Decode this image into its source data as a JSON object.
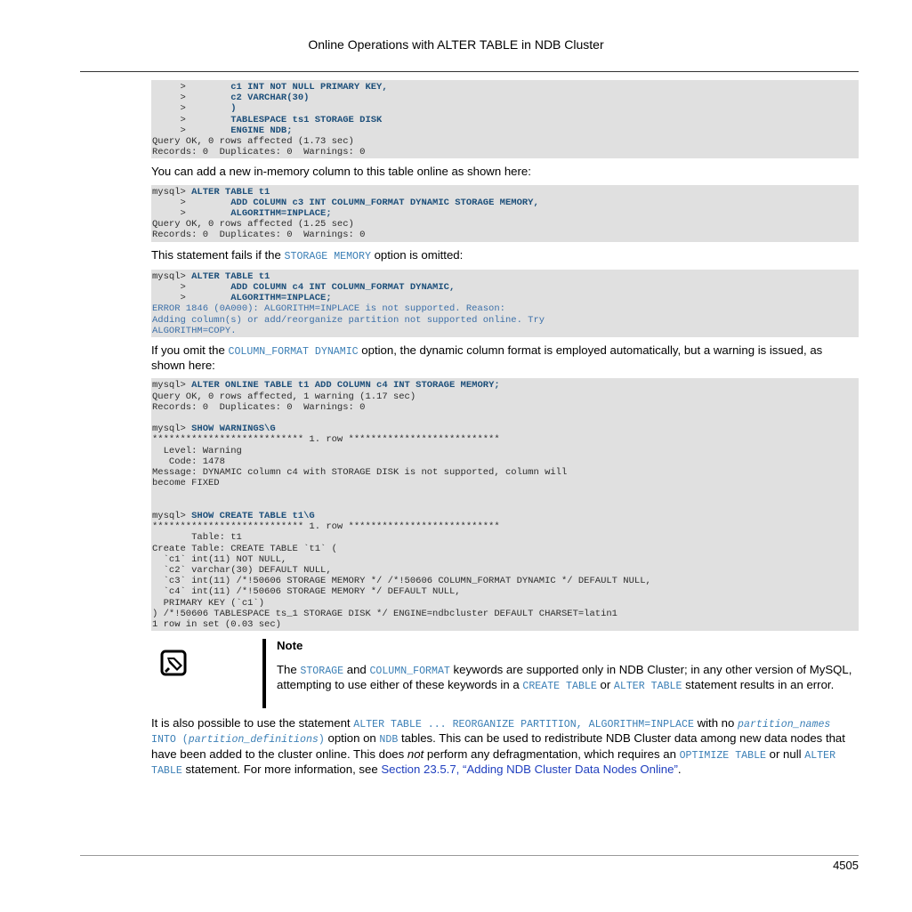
{
  "header": {
    "title": "Online Operations with ALTER TABLE in NDB Cluster"
  },
  "code_blocks": [
    {
      "lines": [
        {
          "segments": [
            {
              "t": "     >        ",
              "s": "plain"
            },
            {
              "t": "c1 INT NOT NULL PRIMARY KEY,",
              "s": "bold"
            }
          ]
        },
        {
          "segments": [
            {
              "t": "     >        ",
              "s": "plain"
            },
            {
              "t": "c2 VARCHAR(30)",
              "s": "bold"
            }
          ]
        },
        {
          "segments": [
            {
              "t": "     >        ",
              "s": "plain"
            },
            {
              "t": ")",
              "s": "bold"
            }
          ]
        },
        {
          "segments": [
            {
              "t": "     >        ",
              "s": "plain"
            },
            {
              "t": "TABLESPACE ts1 STORAGE DISK",
              "s": "bold"
            }
          ]
        },
        {
          "segments": [
            {
              "t": "     >        ",
              "s": "plain"
            },
            {
              "t": "ENGINE NDB;",
              "s": "bold"
            }
          ]
        },
        {
          "segments": [
            {
              "t": "Query OK, 0 rows affected (1.73 sec)",
              "s": "plain"
            }
          ]
        },
        {
          "segments": [
            {
              "t": "Records: 0  Duplicates: 0  Warnings: 0",
              "s": "plain"
            }
          ]
        }
      ]
    },
    {
      "lines": [
        {
          "segments": [
            {
              "t": "mysql> ",
              "s": "plain"
            },
            {
              "t": "ALTER TABLE t1",
              "s": "bold"
            }
          ]
        },
        {
          "segments": [
            {
              "t": "     >        ",
              "s": "plain"
            },
            {
              "t": "ADD COLUMN c3 INT COLUMN_FORMAT DYNAMIC STORAGE MEMORY,",
              "s": "bold"
            }
          ]
        },
        {
          "segments": [
            {
              "t": "     >        ",
              "s": "plain"
            },
            {
              "t": "ALGORITHM=INPLACE;",
              "s": "bold"
            }
          ]
        },
        {
          "segments": [
            {
              "t": "Query OK, 0 rows affected (1.25 sec)",
              "s": "plain"
            }
          ]
        },
        {
          "segments": [
            {
              "t": "Records: 0  Duplicates: 0  Warnings: 0",
              "s": "plain"
            }
          ]
        }
      ]
    },
    {
      "lines": [
        {
          "segments": [
            {
              "t": "mysql> ",
              "s": "plain"
            },
            {
              "t": "ALTER TABLE t1",
              "s": "bold"
            }
          ]
        },
        {
          "segments": [
            {
              "t": "     >        ",
              "s": "plain"
            },
            {
              "t": "ADD COLUMN c4 INT COLUMN_FORMAT DYNAMIC,",
              "s": "bold"
            }
          ]
        },
        {
          "segments": [
            {
              "t": "     >        ",
              "s": "plain"
            },
            {
              "t": "ALGORITHM=INPLACE;",
              "s": "bold"
            }
          ]
        },
        {
          "segments": [
            {
              "t": "ERROR 1846 (0A000): ALGORITHM=INPLACE is not supported. Reason:",
              "s": "err"
            }
          ]
        },
        {
          "segments": [
            {
              "t": "Adding column(s) or add/reorganize partition not supported online. Try",
              "s": "err"
            }
          ]
        },
        {
          "segments": [
            {
              "t": "ALGORITHM=COPY.",
              "s": "err"
            }
          ]
        }
      ]
    },
    {
      "lines": [
        {
          "segments": [
            {
              "t": "mysql> ",
              "s": "plain"
            },
            {
              "t": "ALTER ONLINE TABLE t1 ADD COLUMN c4 INT STORAGE MEMORY;",
              "s": "bold"
            }
          ]
        },
        {
          "segments": [
            {
              "t": "Query OK, 0 rows affected, 1 warning (1.17 sec)",
              "s": "plain"
            }
          ]
        },
        {
          "segments": [
            {
              "t": "Records: 0  Duplicates: 0  Warnings: 0",
              "s": "plain"
            }
          ]
        },
        {
          "segments": [
            {
              "t": "",
              "s": "plain"
            }
          ]
        },
        {
          "segments": [
            {
              "t": "mysql> ",
              "s": "plain"
            },
            {
              "t": "SHOW WARNINGS\\G",
              "s": "bold"
            }
          ]
        },
        {
          "segments": [
            {
              "t": "*************************** 1. row ***************************",
              "s": "plain"
            }
          ]
        },
        {
          "segments": [
            {
              "t": "  Level: Warning",
              "s": "plain"
            }
          ]
        },
        {
          "segments": [
            {
              "t": "   Code: 1478",
              "s": "plain"
            }
          ]
        },
        {
          "segments": [
            {
              "t": "Message: DYNAMIC column c4 with STORAGE DISK is not supported, column will",
              "s": "plain"
            }
          ]
        },
        {
          "segments": [
            {
              "t": "become FIXED",
              "s": "plain"
            }
          ]
        },
        {
          "segments": [
            {
              "t": "",
              "s": "plain"
            }
          ]
        },
        {
          "segments": [
            {
              "t": "",
              "s": "plain"
            }
          ]
        },
        {
          "segments": [
            {
              "t": "mysql> ",
              "s": "plain"
            },
            {
              "t": "SHOW CREATE TABLE t1\\G",
              "s": "bold"
            }
          ]
        },
        {
          "segments": [
            {
              "t": "*************************** 1. row ***************************",
              "s": "plain"
            }
          ]
        },
        {
          "segments": [
            {
              "t": "       Table: t1",
              "s": "plain"
            }
          ]
        },
        {
          "segments": [
            {
              "t": "Create Table: CREATE TABLE `t1` (",
              "s": "plain"
            }
          ]
        },
        {
          "segments": [
            {
              "t": "  `c1` int(11) NOT NULL,",
              "s": "plain"
            }
          ]
        },
        {
          "segments": [
            {
              "t": "  `c2` varchar(30) DEFAULT NULL,",
              "s": "plain"
            }
          ]
        },
        {
          "segments": [
            {
              "t": "  `c3` int(11) /*!50606 STORAGE MEMORY */ /*!50606 COLUMN_FORMAT DYNAMIC */ DEFAULT NULL,",
              "s": "plain"
            }
          ]
        },
        {
          "segments": [
            {
              "t": "  `c4` int(11) /*!50606 STORAGE MEMORY */ DEFAULT NULL,",
              "s": "plain"
            }
          ]
        },
        {
          "segments": [
            {
              "t": "  PRIMARY KEY (`c1`)",
              "s": "plain"
            }
          ]
        },
        {
          "segments": [
            {
              "t": ") /*!50606 TABLESPACE ts_1 STORAGE DISK */ ENGINE=ndbcluster DEFAULT CHARSET=latin1",
              "s": "plain"
            }
          ]
        },
        {
          "segments": [
            {
              "t": "1 row in set (0.03 sec)",
              "s": "plain"
            }
          ]
        }
      ]
    }
  ],
  "paragraphs": [
    {
      "segments": [
        {
          "t": "You can add a new in-memory column to this table online as shown here:",
          "s": "text"
        }
      ]
    },
    {
      "segments": [
        {
          "t": "This statement fails if the ",
          "s": "text"
        },
        {
          "t": "STORAGE MEMORY",
          "s": "lit"
        },
        {
          "t": " option is omitted:",
          "s": "text"
        }
      ]
    },
    {
      "segments": [
        {
          "t": "If you omit the ",
          "s": "text"
        },
        {
          "t": "COLUMN_FORMAT DYNAMIC",
          "s": "lit"
        },
        {
          "t": " option, the dynamic column format is employed automatically, but a warning is issued, as shown here:",
          "s": "text"
        }
      ]
    },
    {
      "segments": [
        {
          "t": "It is also possible to use the statement ",
          "s": "text"
        },
        {
          "t": "ALTER TABLE ... REORGANIZE PARTITION, ALGORITHM=INPLACE",
          "s": "lit"
        },
        {
          "t": " with no ",
          "s": "text"
        },
        {
          "t": "partition_names",
          "s": "litital"
        },
        {
          "t": " INTO (",
          "s": "lit"
        },
        {
          "t": "partition_definitions",
          "s": "litital"
        },
        {
          "t": ")",
          "s": "lit"
        },
        {
          "t": " option on ",
          "s": "text"
        },
        {
          "t": "NDB",
          "s": "lit"
        },
        {
          "t": " tables. This can be used to redistribute NDB Cluster data among new data nodes that have been added to the cluster online. This does ",
          "s": "text"
        },
        {
          "t": "not",
          "s": "ital"
        },
        {
          "t": " perform any defragmentation, which requires an ",
          "s": "text"
        },
        {
          "t": "OPTIMIZE TABLE",
          "s": "lit"
        },
        {
          "t": " or null ",
          "s": "text"
        },
        {
          "t": "ALTER TABLE",
          "s": "lit"
        },
        {
          "t": " statement. For more information, see ",
          "s": "text"
        },
        {
          "t": "Section 23.5.7, “Adding NDB Cluster Data Nodes Online”",
          "s": "link"
        },
        {
          "t": ".",
          "s": "text"
        }
      ]
    }
  ],
  "note": {
    "title": "Note",
    "icon": "note-pencil-icon",
    "segments": [
      {
        "t": "The ",
        "s": "text"
      },
      {
        "t": "STORAGE",
        "s": "lit"
      },
      {
        "t": " and ",
        "s": "text"
      },
      {
        "t": "COLUMN_FORMAT",
        "s": "lit"
      },
      {
        "t": " keywords are supported only in NDB Cluster; in any other version of MySQL, attempting to use either of these keywords in a ",
        "s": "text"
      },
      {
        "t": "CREATE TABLE",
        "s": "lit"
      },
      {
        "t": " or ",
        "s": "text"
      },
      {
        "t": "ALTER TABLE",
        "s": "lit"
      },
      {
        "t": " statement results in an error.",
        "s": "text"
      }
    ]
  },
  "footer": {
    "page_number": "4505"
  },
  "colors": {
    "code_bg": "#e0e0e0",
    "code_keyword": "#1d4f7a",
    "literal": "#3b7fb6",
    "link": "#1f3fbf"
  }
}
